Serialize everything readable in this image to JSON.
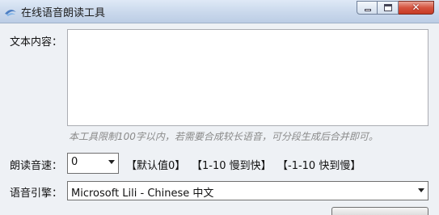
{
  "window": {
    "title": "在线语音朗读工具",
    "controls": [
      "minimize-icon",
      "maximize-icon",
      "close-icon"
    ],
    "close_glyph": "✕"
  },
  "form": {
    "text_label": "文本内容：",
    "text_value": "",
    "hint": "本工具限制100字以内，若需要合成较长语音，可分段生成后合并即可。",
    "speed_label": "朗读音速：",
    "speed_value": "0",
    "speed_notes": [
      "【默认值0】",
      "【1-10 慢到快】",
      "【-1-10 快到慢】"
    ],
    "engine_label": "语音引擎：",
    "engine_value": "Microsoft Lili - Chinese 中文"
  },
  "colors": {
    "titlebar": "#c9d8ec",
    "window_bg": "#eef1f5",
    "close_button": "#d5533f",
    "hint_text": "#8a8a8a"
  }
}
